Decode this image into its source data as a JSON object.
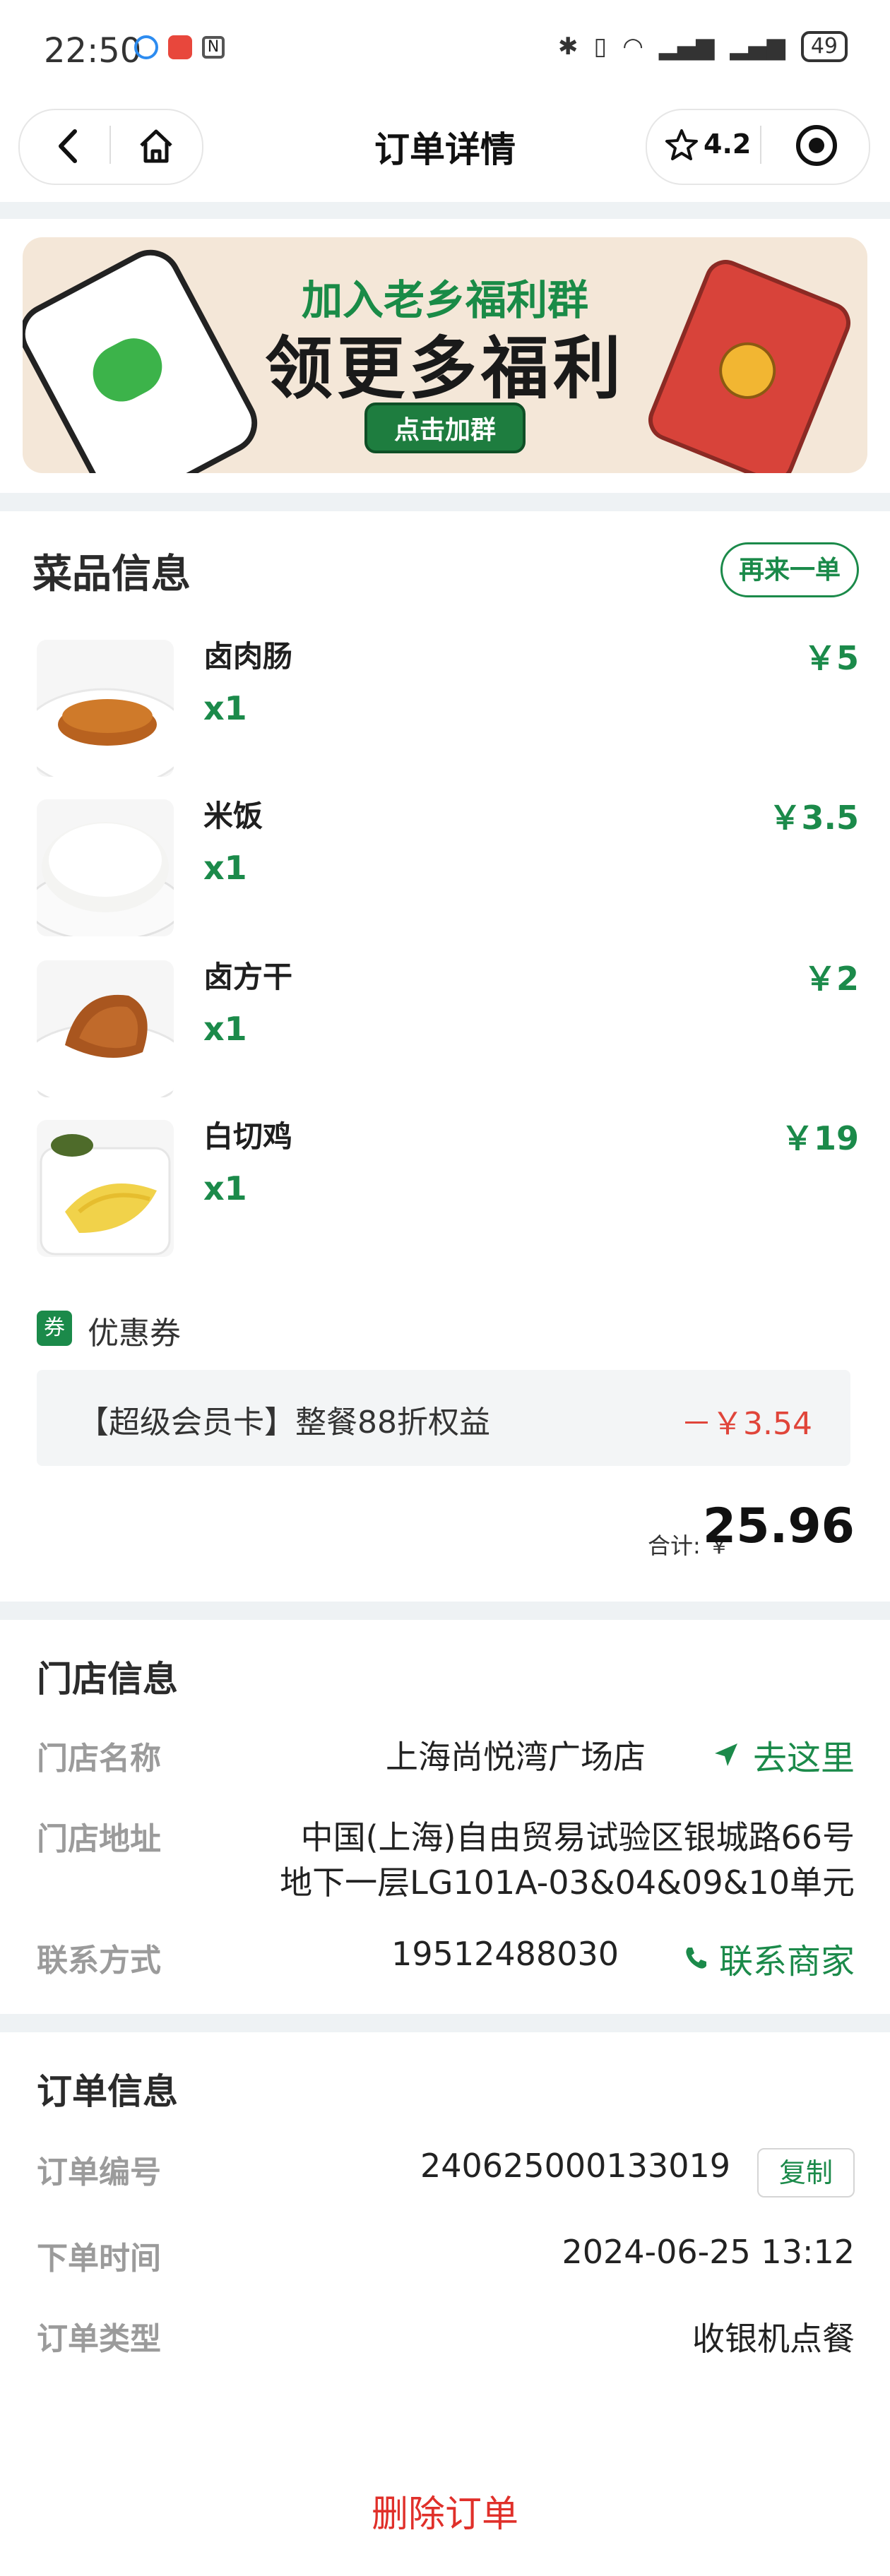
{
  "status_bar": {
    "time": "22:50",
    "battery": "49"
  },
  "nav": {
    "title": "订单详情",
    "rating": "4.2",
    "icons": [
      "back-icon",
      "home-icon",
      "star-icon",
      "record-icon"
    ]
  },
  "banner": {
    "line1": "加入老乡福利群",
    "line2": "领更多福利",
    "button": "点击加群"
  },
  "dishes": {
    "title": "菜品信息",
    "reorder": "再来一单",
    "items": [
      {
        "name": "卤肉肠",
        "qty": "x1",
        "price": "￥5"
      },
      {
        "name": "米饭",
        "qty": "x1",
        "price": "￥3.5"
      },
      {
        "name": "卤方干",
        "qty": "x1",
        "price": "￥2"
      },
      {
        "name": "白切鸡",
        "qty": "x1",
        "price": "￥19"
      }
    ]
  },
  "coupon": {
    "badge": "券",
    "title": "优惠券",
    "name": "【超级会员卡】整餐88折权益",
    "amount": "－￥3.54"
  },
  "total": {
    "label": "合计: ￥",
    "value": "25.96"
  },
  "store": {
    "title": "门店信息",
    "name_label": "门店名称",
    "name": "上海尚悦湾广场店",
    "go": "去这里",
    "addr_label": "门店地址",
    "addr_line1": "中国(上海)自由贸易试验区银城路66号",
    "addr_line2": "地下一层LG101A-03&04&09&10单元",
    "phone_label": "联系方式",
    "phone": "19512488030",
    "contact": "联系商家"
  },
  "order": {
    "title": "订单信息",
    "no_label": "订单编号",
    "no": "240625000133019",
    "copy": "复制",
    "time_label": "下单时间",
    "time": "2024-06-25 13:12",
    "type_label": "订单类型",
    "type": "收银机点餐"
  },
  "delete": "删除订单",
  "colors": {
    "accent": "#1b8a4a",
    "danger": "#e0302a",
    "section_bg": "#eef2f4"
  }
}
